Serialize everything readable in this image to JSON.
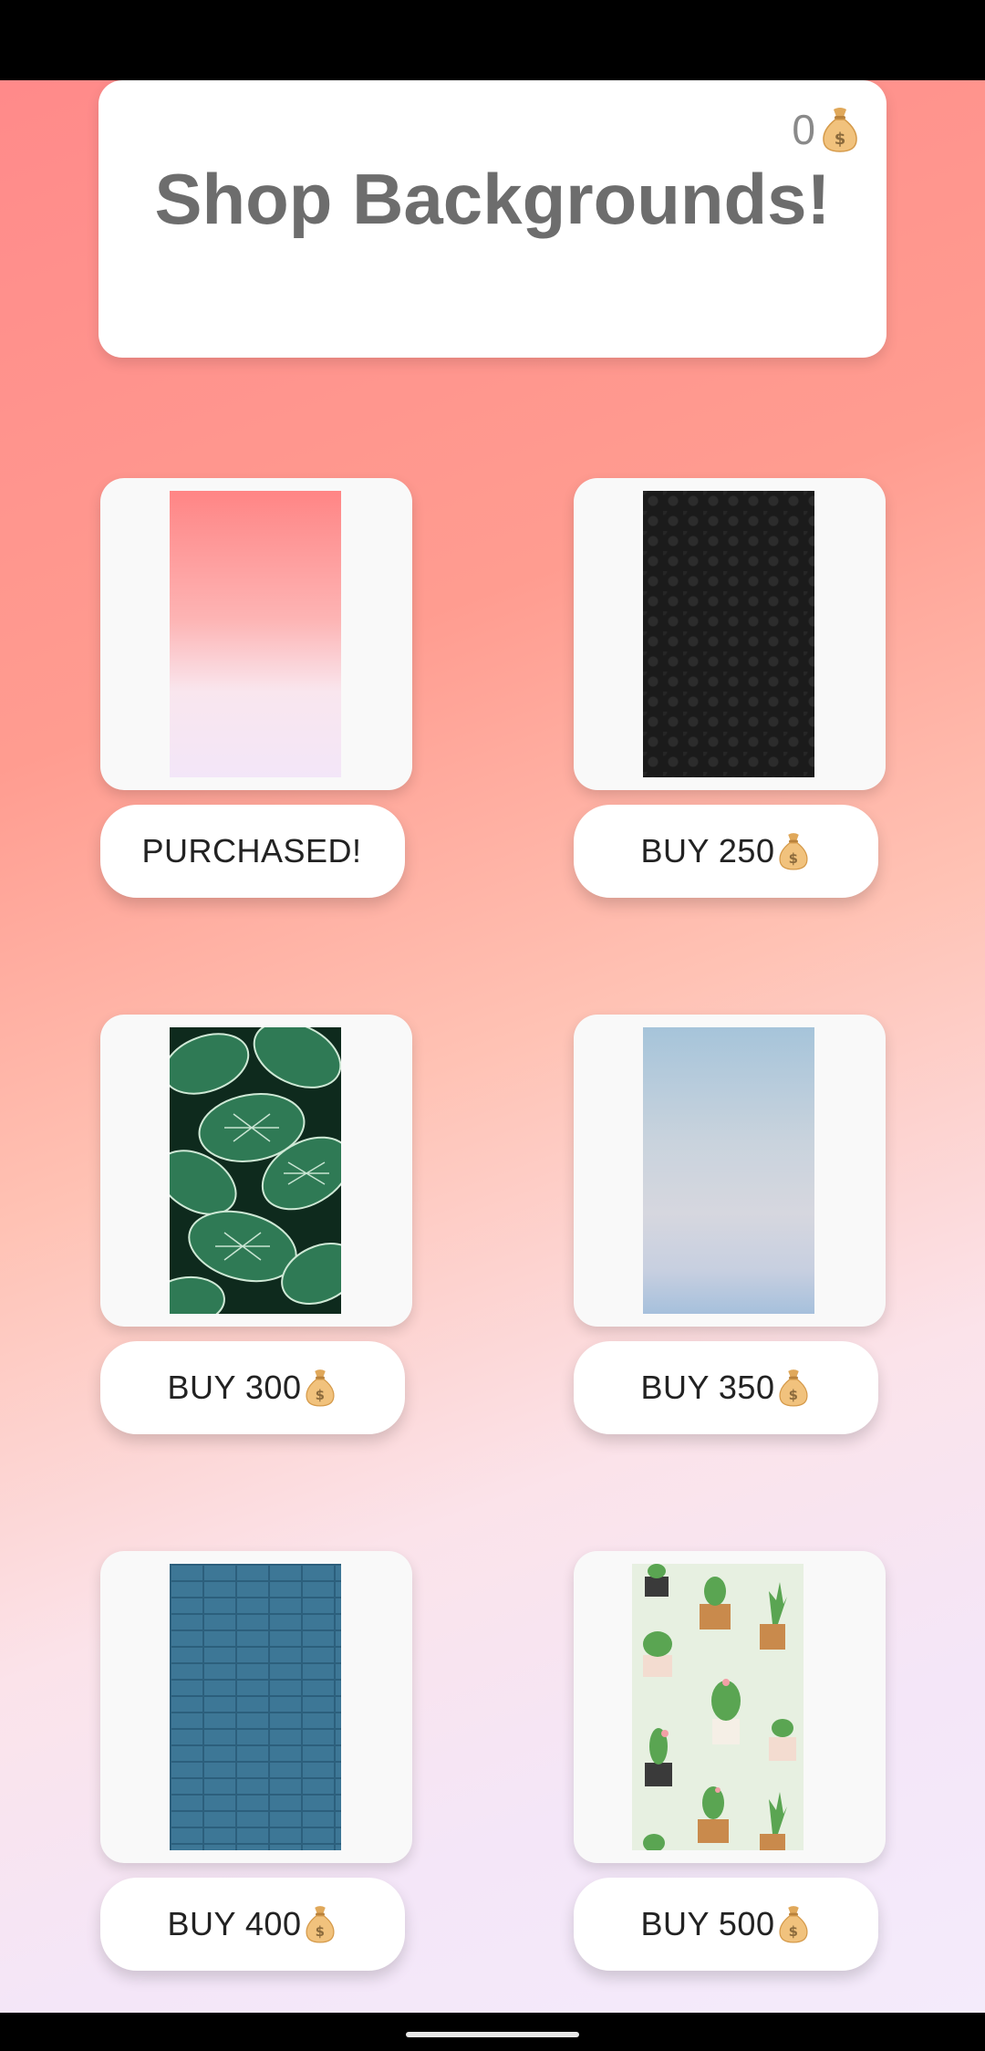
{
  "header": {
    "title": "Shop Backgrounds!",
    "coins": "0",
    "currency_icon": "money-bag-icon"
  },
  "items": [
    {
      "id": "pink-gradient",
      "button_label": "PURCHASED!",
      "show_icon": false,
      "thumbnail": "pink gradient"
    },
    {
      "id": "black-damask",
      "button_label": "BUY 250",
      "show_icon": true,
      "thumbnail": "black damask pattern"
    },
    {
      "id": "green-leaves",
      "button_label": "BUY 300",
      "show_icon": true,
      "thumbnail": "green leaves"
    },
    {
      "id": "pastel-sky",
      "button_label": "BUY 350",
      "show_icon": true,
      "thumbnail": "pastel sky"
    },
    {
      "id": "blue-brick",
      "button_label": "BUY 400",
      "show_icon": true,
      "thumbnail": "blue brick wall"
    },
    {
      "id": "cactus-pattern",
      "button_label": "BUY 500",
      "show_icon": true,
      "thumbnail": "potted cactus pattern"
    }
  ],
  "colors": {
    "title_text": "#6d6d6d",
    "gradient_top": "#ff8a8a",
    "gradient_bottom": "#f4ebfb",
    "card": "#ffffff"
  }
}
